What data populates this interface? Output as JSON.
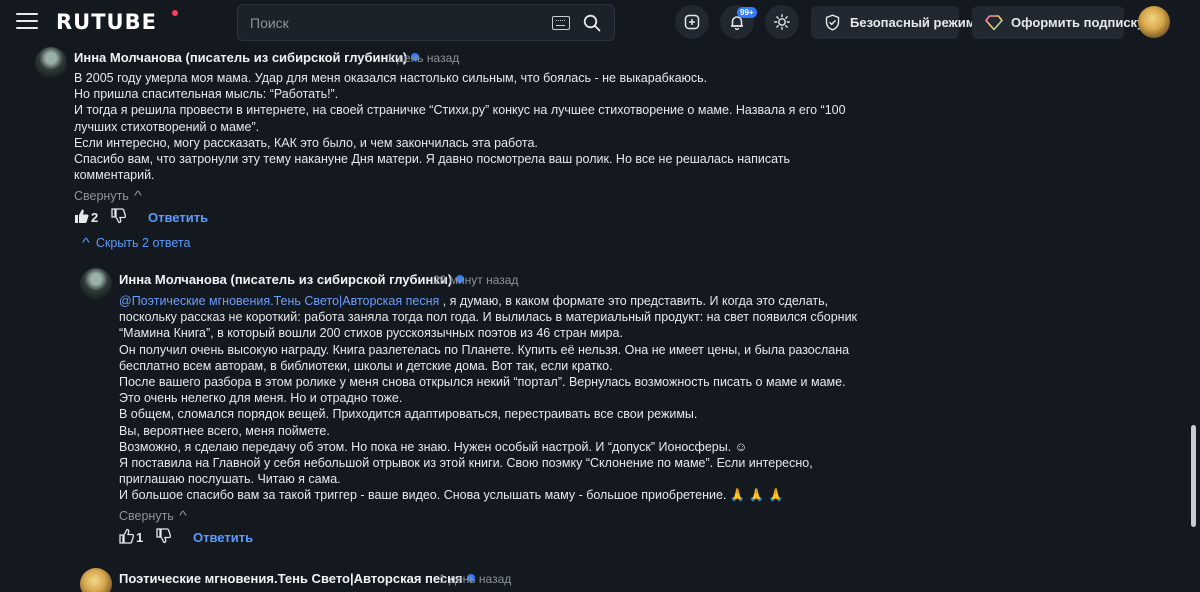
{
  "header": {
    "logo": "RUTUBE",
    "search_placeholder": "Поиск",
    "notifications_badge": "99+",
    "safe_mode_label": "Безопасный режим",
    "subscribe_label": "Оформить подписку"
  },
  "comments": [
    {
      "author": "Инна Молчанова (писатель из сибирской глубинки)",
      "time": "1 день назад",
      "lines": [
        "В 2005 году умерла моя мама. Удар для меня оказался настолько сильным, что боялась - не выкарабкаюсь.",
        "Но пришла спасительная мысль: “Работать!”.",
        "И тогда я решила провести в интернете, на своей страничке “Стихи.ру” конкус на лучшее стихотворение о маме. Назвала я его “100",
        "лучших стихотворений о маме”.",
        "Если интересно, могу рассказать, КАК это было, и чем закончилась эта работа.",
        "Спасибо вам, что затронули эту тему накануне Дня матери. Я давно посмотрела ваш ролик. Но все не решалась написать",
        "комментарий."
      ],
      "collapse_label": "Свернуть",
      "likes": "2",
      "reply_label": "Ответить",
      "hide_replies_label": "Скрыть 2 ответа"
    },
    {
      "author": "Инна Молчанова (писатель из сибирской глубинки)",
      "time": "29 минут назад",
      "mention": "@Поэтические мгновения.Тень Свето|Авторская  песня",
      "first_line_rest": " , я думаю, в каком формате это представить. И когда это сделать,",
      "lines": [
        "поскольку рассказ не короткий: работа заняла тогда пол года. И вылилась в материальный продукт: на свет появился сборник",
        "“Мамина Книга”, в который вошли 200 стихов русскоязычных поэтов из 46 стран мира.",
        "Он получил очень высокую награду. Книга разлетелась по Планете. Купить её нельзя. Она не имеет цены, и была разослана",
        "бесплатно всем авторам, в библиотеки, школы и детские дома. Вот так, если кратко.",
        "После вашего разбора в этом ролике у меня снова открылся некий “портал”. Вернулась возможность писать о маме и маме.",
        "Это очень нелегко для меня. Но и отрадно тоже.",
        "В общем, сломался порядок вещей. Приходится адаптироваться, перестраивать все свои режимы.",
        "Вы, вероятнее всего, меня поймете.",
        "Возможно, я сделаю передачу об этом. Но пока не знаю. Нужен особый настрой. И “допуск” Ионосферы. ☺",
        "Я поставила на Главной у себя небольшой отрывок из этой книги. Свою поэмку “Склонение по маме”. Если интересно,",
        "приглашаю послушать. Читаю я сама.",
        "И большое спасибо вам за такой триггер - ваше видео. Снова услышать маму - большое приобретение. 🙏 🙏 🙏"
      ],
      "collapse_label": "Свернуть",
      "likes": "1",
      "reply_label": "Ответить"
    },
    {
      "author": "Поэтические мгновения.Тень Свето|Авторская песня",
      "time": "1 день назад"
    }
  ]
}
